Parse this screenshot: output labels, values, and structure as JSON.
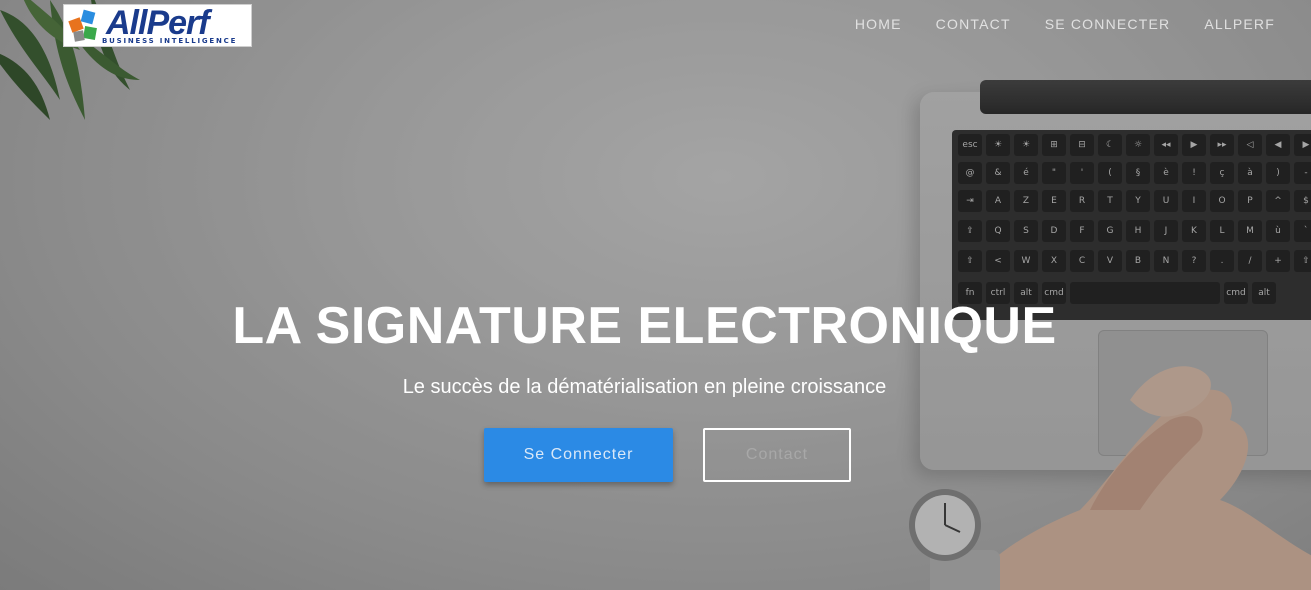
{
  "brand": {
    "logo_name": "AllPerf",
    "logo_tagline": "BUSINESS INTELLIGENCE"
  },
  "nav": {
    "items": [
      {
        "label": "HOME"
      },
      {
        "label": "CONTACT"
      },
      {
        "label": "SE CONNECTER"
      },
      {
        "label": "ALLPERF"
      }
    ]
  },
  "hero": {
    "title": "LA SIGNATURE ELECTRONIQUE",
    "subtitle": "Le succès de la dématérialisation en pleine croissance",
    "primary_button": "Se Connecter",
    "secondary_button": "Contact"
  },
  "keyboard": {
    "rows": [
      [
        "esc",
        "☀",
        "☀",
        "⊞",
        "⊟",
        "☾",
        "☼",
        "◂◂",
        "▶",
        "▸▸",
        "◁",
        "◀",
        "▶"
      ],
      [
        "@",
        "&",
        "é",
        "\"",
        "'",
        "(",
        "§",
        "è",
        "!",
        "ç",
        "à",
        ")",
        "-"
      ],
      [
        "⇥",
        "A",
        "Z",
        "E",
        "R",
        "T",
        "Y",
        "U",
        "I",
        "O",
        "P",
        "^",
        "$"
      ],
      [
        "⇪",
        "Q",
        "S",
        "D",
        "F",
        "G",
        "H",
        "J",
        "K",
        "L",
        "M",
        "ù",
        "`"
      ],
      [
        "⇧",
        "<",
        "W",
        "X",
        "C",
        "V",
        "B",
        "N",
        "?",
        ".",
        "/",
        "+",
        "⇧"
      ]
    ],
    "bottom_left": [
      "fn",
      "ctrl",
      "alt",
      "cmd"
    ],
    "bottom_right": [
      "cmd",
      "alt"
    ]
  },
  "colors": {
    "primary_button": "#2b8ae5",
    "logo_blue": "#1a3b8c"
  }
}
